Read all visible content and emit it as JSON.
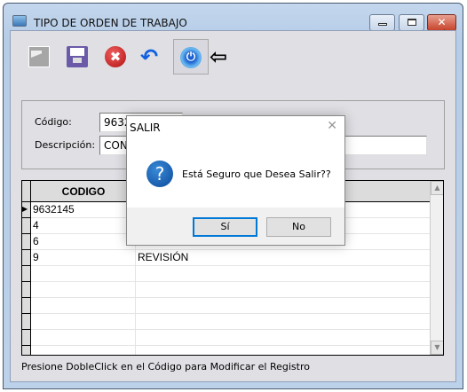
{
  "window": {
    "title": "TIPO DE ORDEN DE TRABAJO"
  },
  "toolbar": [
    "new-icon",
    "save-icon",
    "delete-icon",
    "undo-icon",
    "power-icon"
  ],
  "form": {
    "codigo_label": "Código:",
    "codigo_value": "9632",
    "descripcion_label": "Descripción:",
    "descripcion_value": "CONS"
  },
  "grid": {
    "header": "CODIGO",
    "rows": [
      {
        "codigo": "9632145",
        "descripcion": ""
      },
      {
        "codigo": "4",
        "descripcion": ""
      },
      {
        "codigo": "6",
        "descripcion": ""
      },
      {
        "codigo": "9",
        "descripcion": "REVISIÓN"
      }
    ]
  },
  "footer": "Presione DobleClick en el Código para Modificar el Registro",
  "dialog": {
    "title": "SALIR",
    "message": "Está Seguro que Desea Salir??",
    "yes": "Sí",
    "no": "No"
  }
}
